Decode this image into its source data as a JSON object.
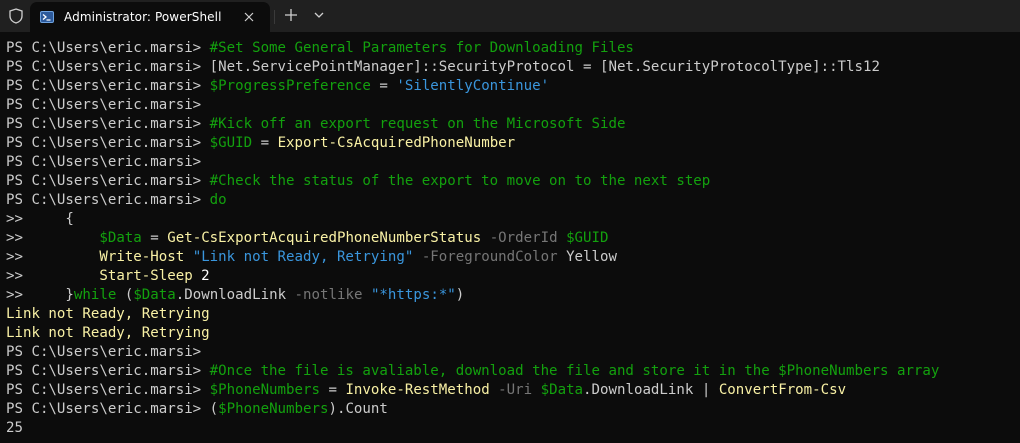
{
  "window": {
    "tab_title": "Administrator: PowerShell",
    "icons": {
      "shield": "shield-icon",
      "tab": "powershell-icon",
      "close": "close-icon",
      "newtab": "plus-icon",
      "dropdown": "chevron-down-icon"
    }
  },
  "colors": {
    "background": "#0c0c0c",
    "titlebar": "#202020",
    "text": "#cccccc",
    "comment": "#13a10e",
    "string": "#3a96dd",
    "command": "#f9f1a5",
    "parameter": "#767676",
    "output_warning": "#f9f1a5"
  },
  "terminal": {
    "lines": [
      [
        {
          "t": "PS C:\\Users\\eric.marsi> ",
          "c": "t-default"
        },
        {
          "t": "#Set Some General Parameters for Downloading Files",
          "c": "t-comment"
        }
      ],
      [
        {
          "t": "PS C:\\Users\\eric.marsi> ",
          "c": "t-default"
        },
        {
          "t": "[Net.ServicePointManager]::SecurityProtocol = [Net.SecurityProtocolType]::Tls12",
          "c": "t-default"
        }
      ],
      [
        {
          "t": "PS C:\\Users\\eric.marsi> ",
          "c": "t-default"
        },
        {
          "t": "$ProgressPreference",
          "c": "t-var"
        },
        {
          "t": " = ",
          "c": "t-default"
        },
        {
          "t": "'SilentlyContinue'",
          "c": "t-string"
        }
      ],
      [
        {
          "t": "PS C:\\Users\\eric.marsi>",
          "c": "t-default"
        }
      ],
      [
        {
          "t": "PS C:\\Users\\eric.marsi> ",
          "c": "t-default"
        },
        {
          "t": "#Kick off an export request on the Microsoft Side",
          "c": "t-comment"
        }
      ],
      [
        {
          "t": "PS C:\\Users\\eric.marsi> ",
          "c": "t-default"
        },
        {
          "t": "$GUID",
          "c": "t-var"
        },
        {
          "t": " = ",
          "c": "t-default"
        },
        {
          "t": "Export-CsAcquiredPhoneNumber",
          "c": "t-cmd"
        }
      ],
      [
        {
          "t": "PS C:\\Users\\eric.marsi>",
          "c": "t-default"
        }
      ],
      [
        {
          "t": "PS C:\\Users\\eric.marsi> ",
          "c": "t-default"
        },
        {
          "t": "#Check the status of the export to move on to the next step",
          "c": "t-comment"
        }
      ],
      [
        {
          "t": "PS C:\\Users\\eric.marsi> ",
          "c": "t-default"
        },
        {
          "t": "do",
          "c": "t-key"
        }
      ],
      [
        {
          "t": ">>     {",
          "c": "t-default"
        }
      ],
      [
        {
          "t": ">>         ",
          "c": "t-default"
        },
        {
          "t": "$Data",
          "c": "t-var"
        },
        {
          "t": " = ",
          "c": "t-default"
        },
        {
          "t": "Get-CsExportAcquiredPhoneNumberStatus",
          "c": "t-cmd"
        },
        {
          "t": " -OrderId ",
          "c": "t-param"
        },
        {
          "t": "$GUID",
          "c": "t-var"
        }
      ],
      [
        {
          "t": ">>         ",
          "c": "t-default"
        },
        {
          "t": "Write-Host",
          "c": "t-cmd"
        },
        {
          "t": " ",
          "c": "t-default"
        },
        {
          "t": "\"Link not Ready, Retrying\"",
          "c": "t-string"
        },
        {
          "t": " -ForegroundColor ",
          "c": "t-param"
        },
        {
          "t": "Yellow",
          "c": "t-default"
        }
      ],
      [
        {
          "t": ">>         ",
          "c": "t-default"
        },
        {
          "t": "Start-Sleep",
          "c": "t-cmd"
        },
        {
          "t": " 2",
          "c": "t-white"
        }
      ],
      [
        {
          "t": ">>     }",
          "c": "t-default"
        },
        {
          "t": "while",
          "c": "t-key"
        },
        {
          "t": " (",
          "c": "t-default"
        },
        {
          "t": "$Data",
          "c": "t-var"
        },
        {
          "t": ".DownloadLink ",
          "c": "t-default"
        },
        {
          "t": "-notlike",
          "c": "t-param"
        },
        {
          "t": " ",
          "c": "t-default"
        },
        {
          "t": "\"*https:*\"",
          "c": "t-string"
        },
        {
          "t": ")",
          "c": "t-default"
        }
      ],
      [
        {
          "t": "Link not Ready, Retrying",
          "c": "t-output"
        }
      ],
      [
        {
          "t": "Link not Ready, Retrying",
          "c": "t-output"
        }
      ],
      [
        {
          "t": "PS C:\\Users\\eric.marsi>",
          "c": "t-default"
        }
      ],
      [
        {
          "t": "PS C:\\Users\\eric.marsi> ",
          "c": "t-default"
        },
        {
          "t": "#Once the file is avaliable, download the file and store it in the $PhoneNumbers array",
          "c": "t-comment"
        }
      ],
      [
        {
          "t": "PS C:\\Users\\eric.marsi> ",
          "c": "t-default"
        },
        {
          "t": "$PhoneNumbers",
          "c": "t-var"
        },
        {
          "t": " = ",
          "c": "t-default"
        },
        {
          "t": "Invoke-RestMethod",
          "c": "t-cmd"
        },
        {
          "t": " -Uri ",
          "c": "t-param"
        },
        {
          "t": "$Data",
          "c": "t-var"
        },
        {
          "t": ".DownloadLink | ",
          "c": "t-default"
        },
        {
          "t": "ConvertFrom-Csv",
          "c": "t-cmd"
        }
      ],
      [
        {
          "t": "PS C:\\Users\\eric.marsi> ",
          "c": "t-default"
        },
        {
          "t": "(",
          "c": "t-default"
        },
        {
          "t": "$PhoneNumbers",
          "c": "t-var"
        },
        {
          "t": ").Count",
          "c": "t-default"
        }
      ],
      [
        {
          "t": "25",
          "c": "t-default"
        }
      ]
    ]
  }
}
